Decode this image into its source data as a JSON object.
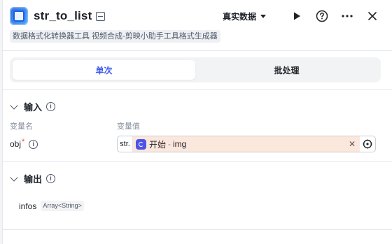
{
  "header": {
    "title": "str_to_list",
    "data_source": "真实数据",
    "subtitle": "数据格式化转换器工具 视频合成-剪映小助手工具格式生成器"
  },
  "tabs": [
    {
      "label": "单次",
      "active": true
    },
    {
      "label": "批处理",
      "active": false
    }
  ],
  "input": {
    "heading": "输入",
    "col_name": "变量名",
    "col_value": "变量值",
    "param": {
      "name": "obj",
      "required_mark": "*",
      "type_tag": "str.",
      "ref_source": "开始",
      "ref_separator": "-",
      "ref_field": "img"
    }
  },
  "output": {
    "heading": "输出",
    "var_name": "infos",
    "var_type": "Array<String>"
  },
  "colors": {
    "accent": "#3d5af1",
    "ref_chip_bg": "#fbe7dc",
    "ref_icon": "#4d53e8",
    "required": "#f53f3f"
  },
  "icons": {
    "app": "app-logo-icon",
    "title_action": "panel-icon",
    "run": "play-icon",
    "help": "question-circle-icon",
    "more": "more-horizontal-icon",
    "close": "close-icon",
    "expand": "chevron-down-icon",
    "info": "info-circle-icon",
    "clear": "clear-icon",
    "target": "target-icon"
  }
}
